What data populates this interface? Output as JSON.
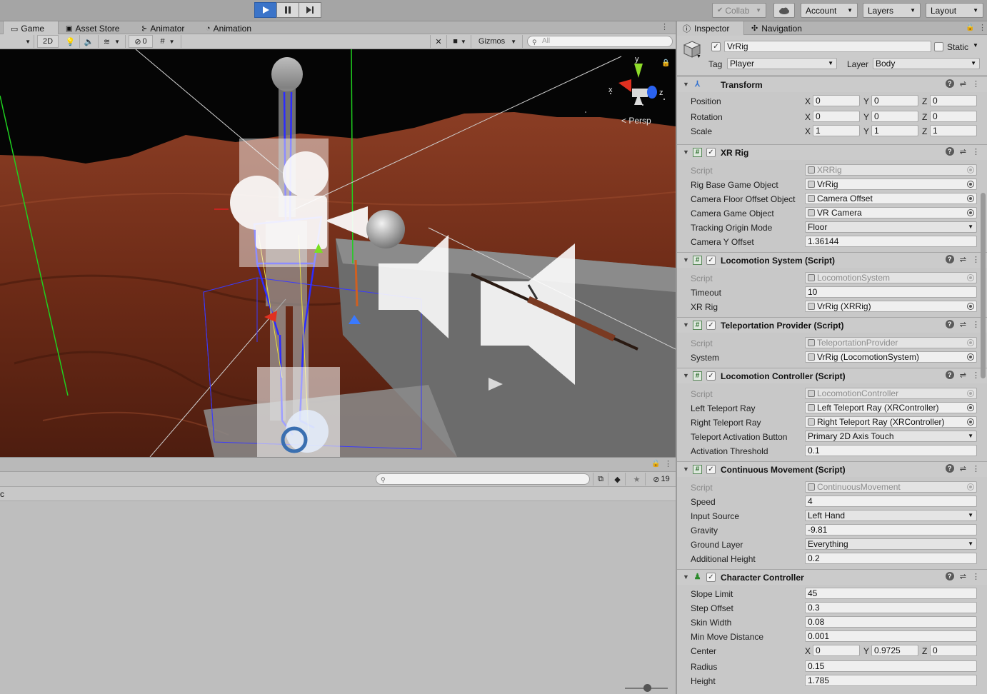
{
  "toolbar": {
    "collab": "Collab",
    "account": "Account",
    "layers": "Layers",
    "layout": "Layout"
  },
  "scene": {
    "tabs": [
      "Game",
      "Asset Store",
      "Animator",
      "Animation"
    ],
    "mode_2d": "2D",
    "hidden_count": "0",
    "gizmos": "Gizmos",
    "search_placeholder": "All",
    "projection": "Persp",
    "axis_x": "x",
    "axis_y": "y",
    "axis_z": "z"
  },
  "console": {
    "message_count": "19",
    "column_label": "c"
  },
  "inspector": {
    "tabs": [
      "Inspector",
      "Navigation"
    ],
    "object_name": "VrRig",
    "static_label": "Static",
    "tag_label": "Tag",
    "tag_value": "Player",
    "layer_label": "Layer",
    "layer_value": "Body",
    "transform": {
      "title": "Transform",
      "rows": [
        {
          "label": "Position",
          "x": "0",
          "y": "0",
          "z": "0"
        },
        {
          "label": "Rotation",
          "x": "0",
          "y": "0",
          "z": "0"
        },
        {
          "label": "Scale",
          "x": "1",
          "y": "1",
          "z": "1"
        }
      ]
    },
    "components": [
      {
        "title": "XR Rig",
        "rows": [
          {
            "label": "Script",
            "value": "XRRig",
            "kind": "script"
          },
          {
            "label": "Rig Base Game Object",
            "value": "VrRig",
            "kind": "object"
          },
          {
            "label": "Camera Floor Offset Object",
            "value": "Camera Offset",
            "kind": "object"
          },
          {
            "label": "Camera Game Object",
            "value": "VR Camera",
            "kind": "object"
          },
          {
            "label": "Tracking Origin Mode",
            "value": "Floor",
            "kind": "dropdown"
          },
          {
            "label": "Camera Y Offset",
            "value": "1.36144",
            "kind": "text"
          }
        ]
      },
      {
        "title": "Locomotion System (Script)",
        "rows": [
          {
            "label": "Script",
            "value": "LocomotionSystem",
            "kind": "script"
          },
          {
            "label": "Timeout",
            "value": "10",
            "kind": "text"
          },
          {
            "label": "XR Rig",
            "value": "VrRig (XRRig)",
            "kind": "object"
          }
        ]
      },
      {
        "title": "Teleportation Provider (Script)",
        "rows": [
          {
            "label": "Script",
            "value": "TeleportationProvider",
            "kind": "script"
          },
          {
            "label": "System",
            "value": "VrRig (LocomotionSystem)",
            "kind": "object"
          }
        ]
      },
      {
        "title": "Locomotion Controller (Script)",
        "rows": [
          {
            "label": "Script",
            "value": "LocomotionController",
            "kind": "script"
          },
          {
            "label": "Left Teleport Ray",
            "value": "Left Teleport Ray (XRController)",
            "kind": "object"
          },
          {
            "label": "Right Teleport Ray",
            "value": "Right Teleport Ray (XRController)",
            "kind": "object"
          },
          {
            "label": "Teleport Activation Button",
            "value": "Primary 2D Axis Touch",
            "kind": "dropdown"
          },
          {
            "label": "Activation Threshold",
            "value": "0.1",
            "kind": "text"
          }
        ]
      },
      {
        "title": "Continuous Movement (Script)",
        "rows": [
          {
            "label": "Script",
            "value": "ContinuousMovement",
            "kind": "script"
          },
          {
            "label": "Speed",
            "value": "4",
            "kind": "text"
          },
          {
            "label": "Input Source",
            "value": "Left Hand",
            "kind": "dropdown"
          },
          {
            "label": "Gravity",
            "value": "-9.81",
            "kind": "text"
          },
          {
            "label": "Ground Layer",
            "value": "Everything",
            "kind": "dropdown"
          },
          {
            "label": "Additional Height",
            "value": "0.2",
            "kind": "text"
          }
        ]
      }
    ],
    "character_controller": {
      "title": "Character Controller",
      "slope_limit_label": "Slope Limit",
      "slope_limit": "45",
      "step_offset_label": "Step Offset",
      "step_offset": "0.3",
      "skin_width_label": "Skin Width",
      "skin_width": "0.08",
      "min_move_label": "Min Move Distance",
      "min_move": "0.001",
      "center_label": "Center",
      "center_x": "0",
      "center_y": "0.9725",
      "center_z": "0",
      "radius_label": "Radius",
      "radius": "0.15",
      "height_label": "Height",
      "height": "1.785"
    }
  }
}
